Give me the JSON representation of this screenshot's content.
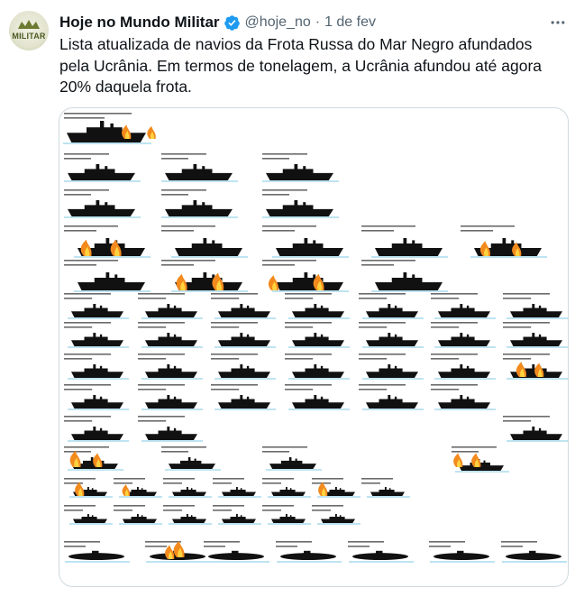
{
  "tweet": {
    "author": {
      "display_name": "Hoje no Mundo Militar",
      "handle": "@hoje_no",
      "avatar_text": "MILITAR",
      "verified": true,
      "verified_color": "#1d9bf0"
    },
    "separator": "·",
    "date": "1 de fev",
    "text": "Lista atualizada de navios da Frota Russa do Mar Negro afundados pela Ucrânia. Em termos de tonelagem, a Ucrânia afundou até agora 20% daquela frota.",
    "media": {
      "alt_type": "infographic of ship silhouettes",
      "colors": {
        "ship": "#111111",
        "fire": "#f28a1e",
        "flame_core": "#ffd23f",
        "waterline": "#7ec8e3"
      }
    }
  },
  "icons": {
    "more": "more-horizontal-icon",
    "verified": "verified-badge-icon"
  }
}
